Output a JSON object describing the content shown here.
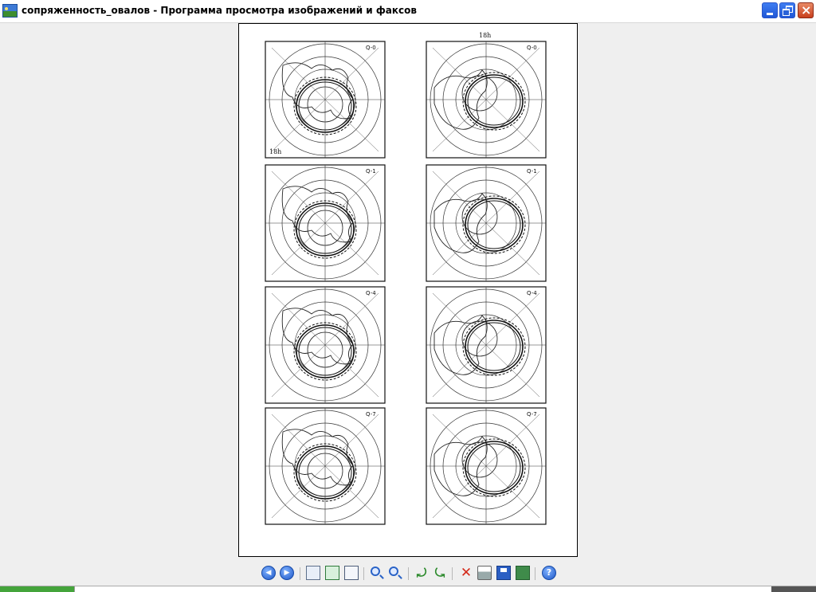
{
  "window": {
    "title": "сопряженность_овалов - Программа просмотра изображений и факсов"
  },
  "figure": {
    "left_top_time": "18h",
    "right_top_time": "18h",
    "panel_labels": [
      "Q-0",
      "Q-1",
      "Q-4",
      "Q-7"
    ]
  },
  "toolbar": {
    "buttons": [
      "previous-image",
      "next-image",
      "best-fit",
      "actual-size",
      "slideshow",
      "zoom-in",
      "zoom-out",
      "rotate-clockwise",
      "rotate-counterclockwise",
      "delete",
      "print",
      "copy-to",
      "open-for-editing",
      "help"
    ]
  }
}
